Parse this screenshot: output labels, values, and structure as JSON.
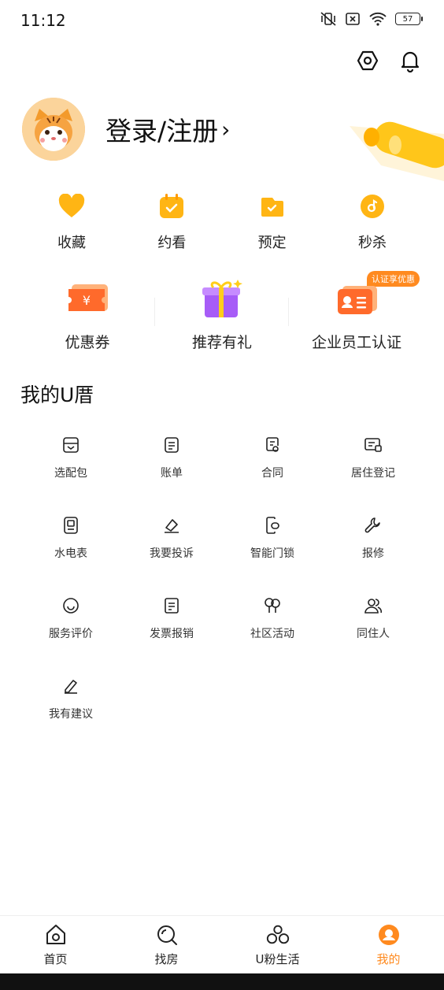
{
  "status_bar": {
    "time": "11:12",
    "battery": "57"
  },
  "profile": {
    "login_text": "登录/注册",
    "arrow": "›"
  },
  "quick_actions": [
    {
      "label": "收藏",
      "icon": "heart-icon"
    },
    {
      "label": "约看",
      "icon": "calendar-icon"
    },
    {
      "label": "预定",
      "icon": "reserve-icon"
    },
    {
      "label": "秒杀",
      "icon": "flash-sale-icon"
    }
  ],
  "promos": [
    {
      "label": "优惠券",
      "icon": "coupon-icon"
    },
    {
      "label": "推荐有礼",
      "icon": "gift-icon"
    },
    {
      "label": "企业员工认证",
      "icon": "id-card-icon",
      "badge": "认证享优惠"
    }
  ],
  "section": {
    "title": "我的U厝"
  },
  "services": [
    {
      "label": "选配包",
      "icon": "package-icon"
    },
    {
      "label": "账单",
      "icon": "bill-icon"
    },
    {
      "label": "合同",
      "icon": "contract-icon"
    },
    {
      "label": "居住登记",
      "icon": "registration-icon"
    },
    {
      "label": "水电表",
      "icon": "meter-icon"
    },
    {
      "label": "我要投诉",
      "icon": "complaint-icon"
    },
    {
      "label": "智能门锁",
      "icon": "smart-lock-icon"
    },
    {
      "label": "报修",
      "icon": "wrench-icon"
    },
    {
      "label": "服务评价",
      "icon": "smile-icon"
    },
    {
      "label": "发票报销",
      "icon": "invoice-icon"
    },
    {
      "label": "社区活动",
      "icon": "balloon-icon"
    },
    {
      "label": "同住人",
      "icon": "roommates-icon"
    },
    {
      "label": "我有建议",
      "icon": "pencil-icon"
    }
  ],
  "tabs": [
    {
      "label": "首页",
      "icon": "home-icon",
      "active": false
    },
    {
      "label": "找房",
      "icon": "search-icon",
      "active": false
    },
    {
      "label": "U粉生活",
      "icon": "bubbles-icon",
      "active": false
    },
    {
      "label": "我的",
      "icon": "profile-icon",
      "active": true
    }
  ],
  "colors": {
    "accent": "#ff8a1f",
    "icon_yellow": "#ffb514",
    "text": "#1a1a1a"
  }
}
